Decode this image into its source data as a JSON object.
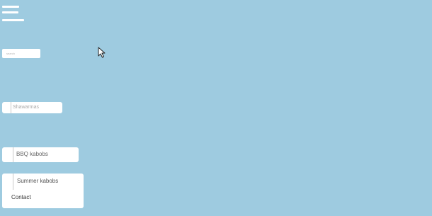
{
  "header": {
    "menu_icon": "hamburger-icon"
  },
  "search": {
    "placeholder": "search"
  },
  "nav": {
    "items": [
      {
        "label": "Shawarmas"
      },
      {
        "label": "BBQ kabobs"
      },
      {
        "label": "Summer kabobs"
      },
      {
        "label": "Contact"
      }
    ]
  },
  "cursor": {
    "icon": "pointer-cursor-icon"
  },
  "colors": {
    "background": "#9ecbe0",
    "card": "#ffffff",
    "divider": "#c9c9c9"
  }
}
